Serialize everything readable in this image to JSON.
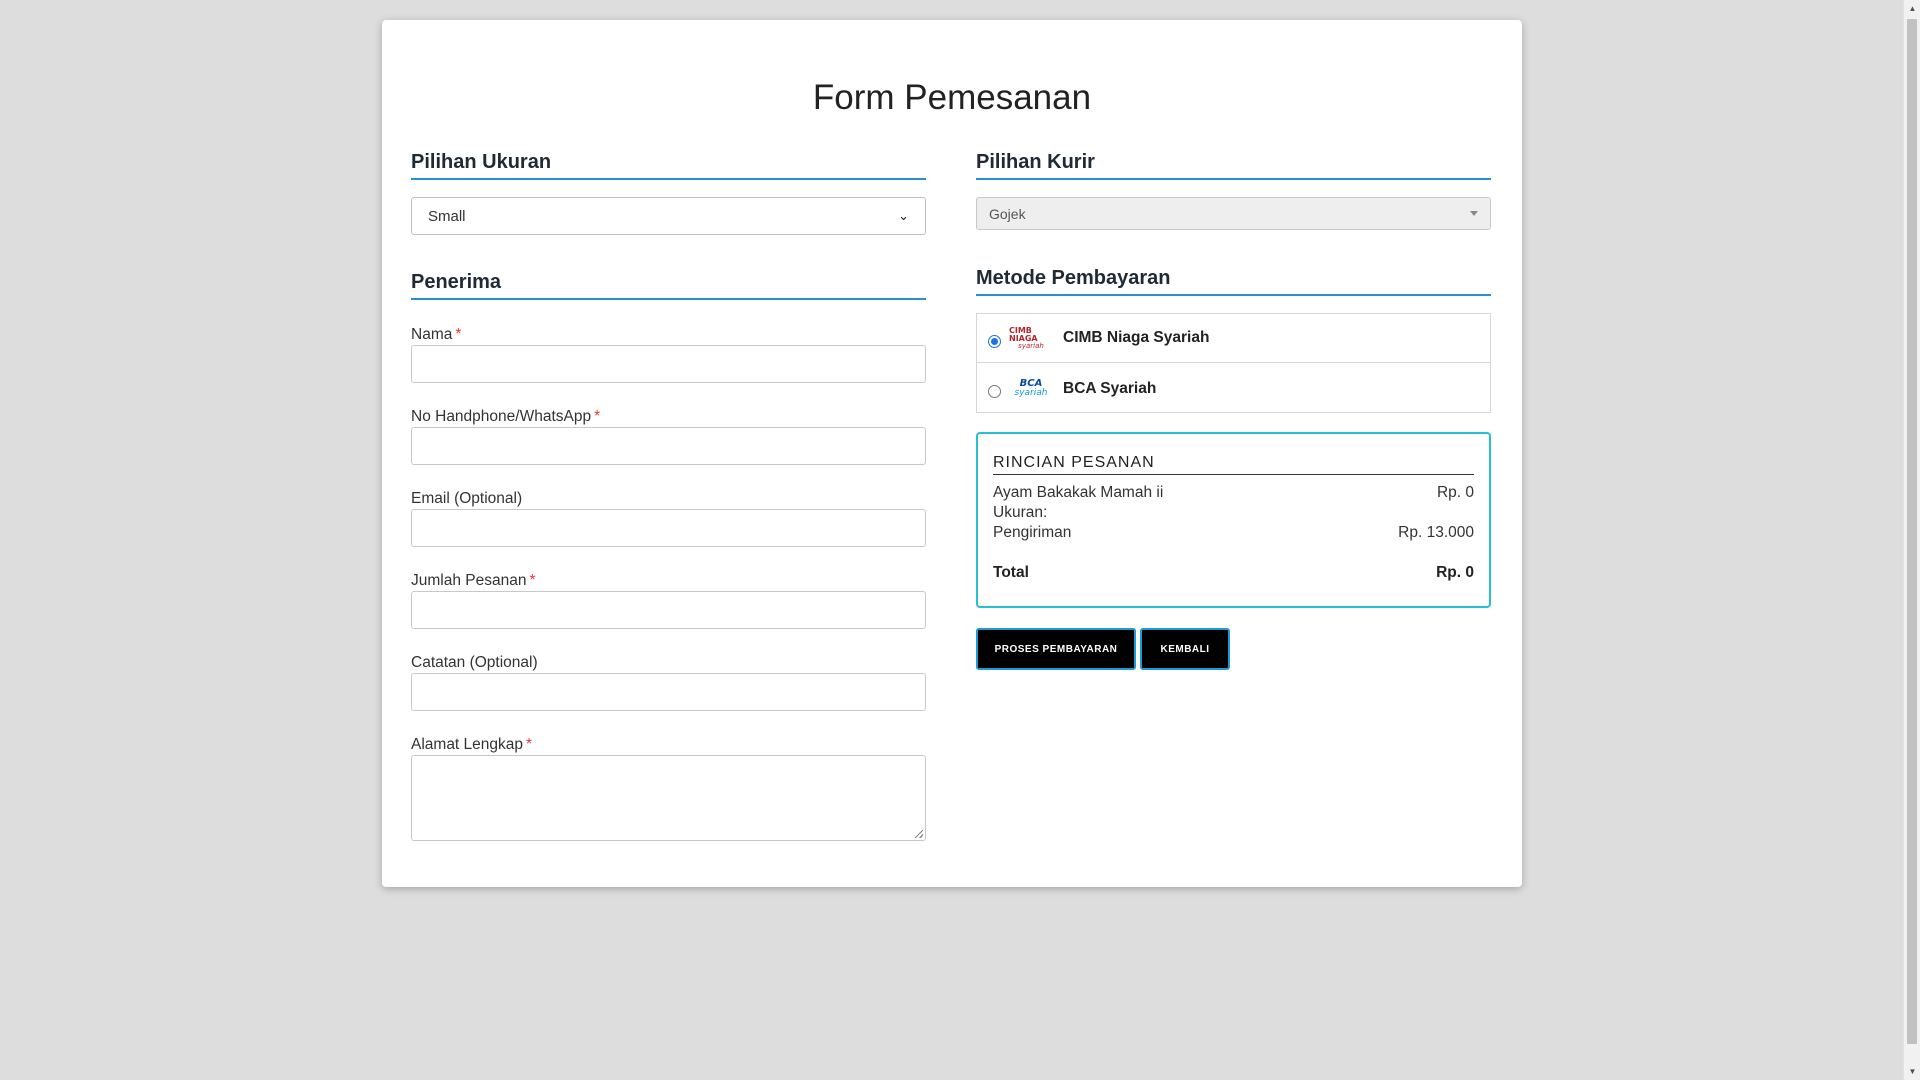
{
  "page": {
    "title": "Form Pemesanan"
  },
  "size_section": {
    "title": "Pilihan Ukuran",
    "selected": "Small"
  },
  "recipient_section": {
    "title": "Penerima",
    "fields": {
      "name_label": "Nama",
      "phone_label": "No Handphone/WhatsApp",
      "email_label": "Email (Optional)",
      "quantity_label": "Jumlah Pesanan",
      "notes_label": "Catatan (Optional)",
      "address_label": "Alamat Lengkap",
      "required_mark": "*"
    }
  },
  "courier_section": {
    "title": "Pilihan Kurir",
    "selected": "Gojek"
  },
  "payment_section": {
    "title": "Metode Pembayaran",
    "options": [
      {
        "label": "CIMB Niaga Syariah",
        "logo_line1": "CIMB NIAGA",
        "logo_line2": "syariah",
        "checked": true
      },
      {
        "label": "BCA Syariah",
        "logo_line1": "BCA",
        "logo_line2": "syariah",
        "checked": false
      }
    ]
  },
  "order_summary": {
    "title": "RINCIAN PESANAN",
    "product_name": "Ayam Bakakak Mamah ii",
    "product_price": "Rp. 0",
    "size_label": "Ukuran:",
    "size_value": "",
    "shipping_label": "Pengiriman",
    "shipping_price": "Rp. 13.000",
    "total_label": "Total",
    "total_value": "Rp. 0"
  },
  "actions": {
    "process_label": "PROSES PEMBAYARAN",
    "back_label": "KEMBALI"
  },
  "colors": {
    "accent_blue": "#2a8fd0",
    "summary_border": "#23c1d1",
    "button_bg": "#000000",
    "required": "#e53935"
  }
}
